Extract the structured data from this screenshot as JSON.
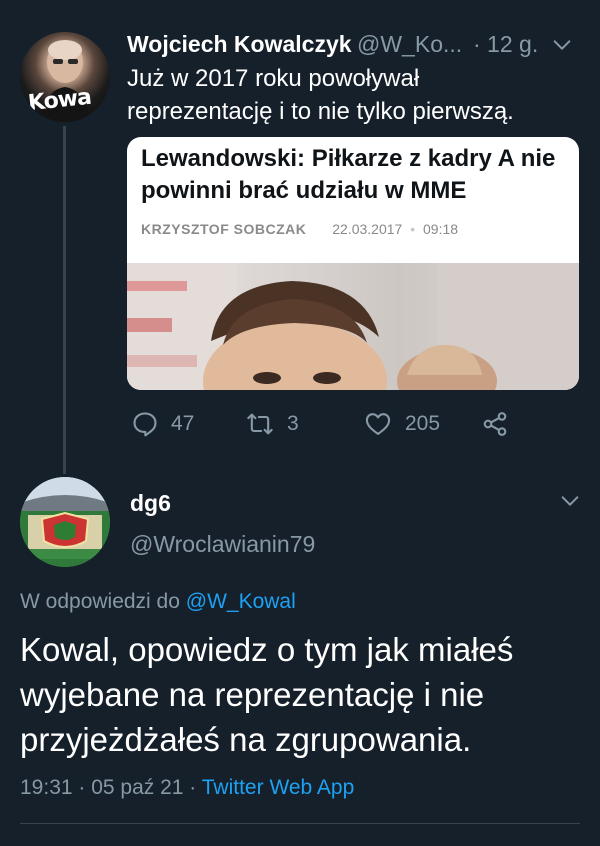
{
  "tweet": {
    "author_name": "Wojciech Kowalczyk",
    "author_handle": "@W_Ko...",
    "time": "· 12 g.",
    "avatar_text": "Kowa",
    "text": "Już w 2017 roku powoływał reprezentację i to nie tylko pierwszą.",
    "card": {
      "title": "Lewandowski: Piłkarze z kadry A nie powinni brać udziału w MME",
      "author": "KRZYSZTOF SOBCZAK",
      "date": "22.03.2017",
      "time": "09:18"
    },
    "actions": {
      "replies": "47",
      "retweets": "3",
      "likes": "205"
    }
  },
  "reply": {
    "author_name": "dg6",
    "author_handle": "@Wroclawianin79",
    "replying_to_label": "W odpowiedzi do",
    "replying_to_handle": "@W_Kowal",
    "text": "Kowal, opowiedz o tym jak miałeś wyjebane na reprezentację i nie przyjeżdżałeś na zgrupowania.",
    "timestamp": "19:31 · 05 paź 21 ·",
    "source": "Twitter Web App"
  },
  "colors": {
    "background": "#15202b",
    "secondary_text": "#8899a6",
    "link": "#1da1f2",
    "divider": "#38444d"
  }
}
